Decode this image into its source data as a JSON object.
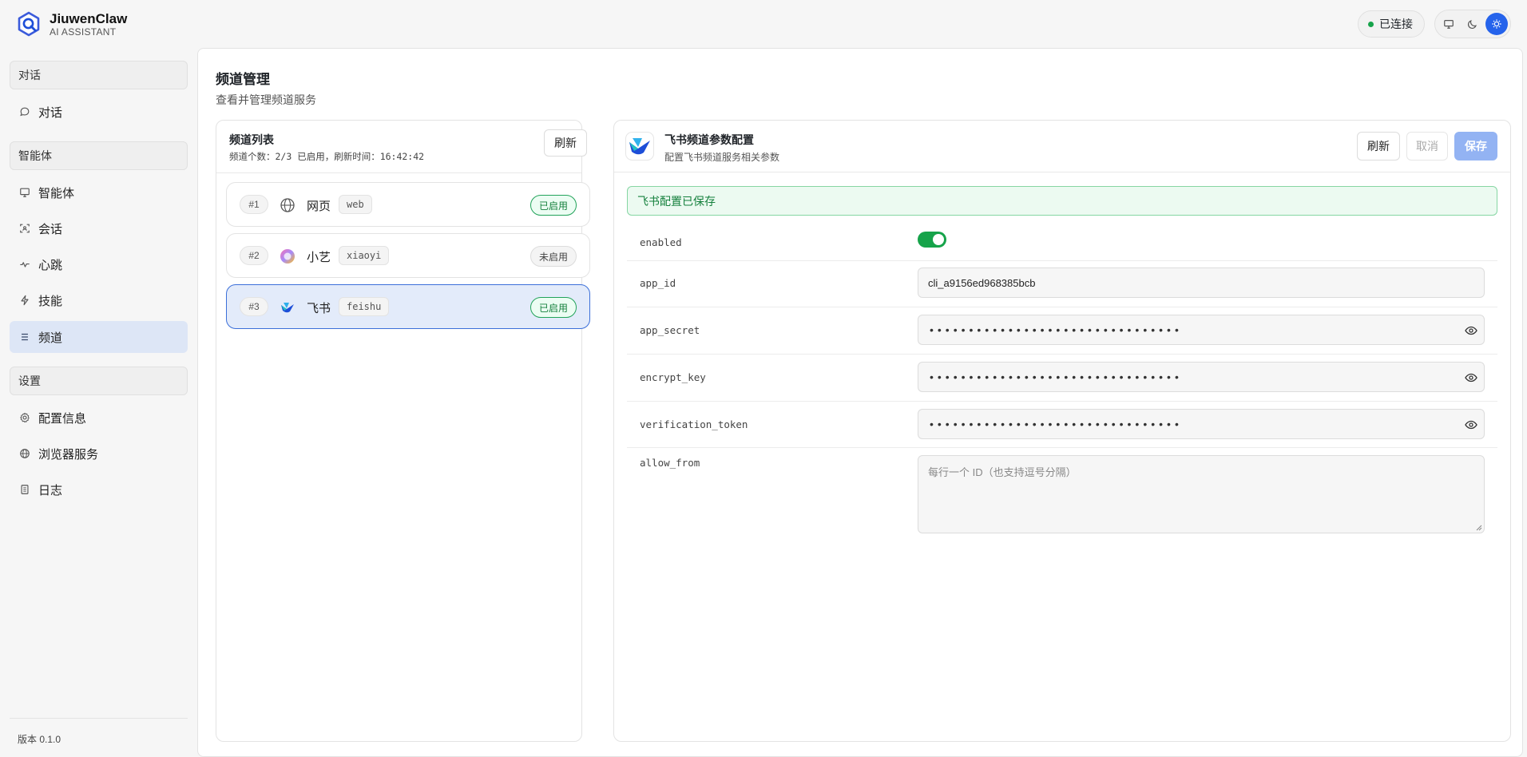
{
  "app": {
    "name": "JiuwenClaw",
    "subtitle": "AI ASSISTANT",
    "connection_status": "已连接",
    "theme_options": [
      "desktop-icon",
      "moon-icon",
      "sun-icon"
    ],
    "active_theme": "sun-icon"
  },
  "sidebar": {
    "sections": [
      {
        "label": "对话",
        "items": [
          {
            "label": "对话",
            "icon": "chat-bubble-icon"
          }
        ]
      },
      {
        "label": "智能体",
        "items": [
          {
            "label": "智能体",
            "icon": "monitor-icon"
          },
          {
            "label": "会话",
            "icon": "scan-icon"
          },
          {
            "label": "心跳",
            "icon": "pulse-icon"
          },
          {
            "label": "技能",
            "icon": "lightning-icon"
          },
          {
            "label": "频道",
            "icon": "list-icon",
            "active": true
          }
        ]
      },
      {
        "label": "设置",
        "items": [
          {
            "label": "配置信息",
            "icon": "gear-icon"
          },
          {
            "label": "浏览器服务",
            "icon": "globe-icon"
          },
          {
            "label": "日志",
            "icon": "document-icon"
          }
        ]
      }
    ],
    "version": "版本 0.1.0"
  },
  "page": {
    "title": "频道管理",
    "subtitle": "查看并管理频道服务"
  },
  "channel_list": {
    "title": "频道列表",
    "meta": "频道个数：2/3 已启用，刷新时间：16:42:42",
    "refresh_label": "刷新",
    "channels": [
      {
        "num": "#1",
        "name": "网页",
        "code": "web",
        "status": "已启用",
        "enabled": true,
        "icon": "globe-icon"
      },
      {
        "num": "#2",
        "name": "小艺",
        "code": "xiaoyi",
        "status": "未启用",
        "enabled": false,
        "icon": "xiaoyi-icon"
      },
      {
        "num": "#3",
        "name": "飞书",
        "code": "feishu",
        "status": "已启用",
        "enabled": true,
        "icon": "feishu-icon",
        "selected": true
      }
    ]
  },
  "detail": {
    "title": "飞书频道参数配置",
    "subtitle": "配置飞书频道服务相关参数",
    "refresh_label": "刷新",
    "cancel_label": "取消",
    "save_label": "保存",
    "alert": "飞书配置已保存",
    "fields": {
      "enabled": {
        "label": "enabled",
        "value": true
      },
      "app_id": {
        "label": "app_id",
        "value": "cli_a9156ed968385bcb"
      },
      "app_secret": {
        "label": "app_secret",
        "value": "••••••••••••••••••••••••••••••••"
      },
      "encrypt_key": {
        "label": "encrypt_key",
        "value": "••••••••••••••••••••••••••••••••"
      },
      "verification_token": {
        "label": "verification_token",
        "value": "••••••••••••••••••••••••••••••••"
      },
      "allow_from": {
        "label": "allow_from",
        "value": "",
        "placeholder": "每行一个 ID（也支持逗号分隔）"
      }
    }
  },
  "colors": {
    "accent": "#2563eb",
    "success": "#16a34a",
    "selected_bg": "#e3ebfa",
    "primary_disabled": "#93b3f3"
  }
}
